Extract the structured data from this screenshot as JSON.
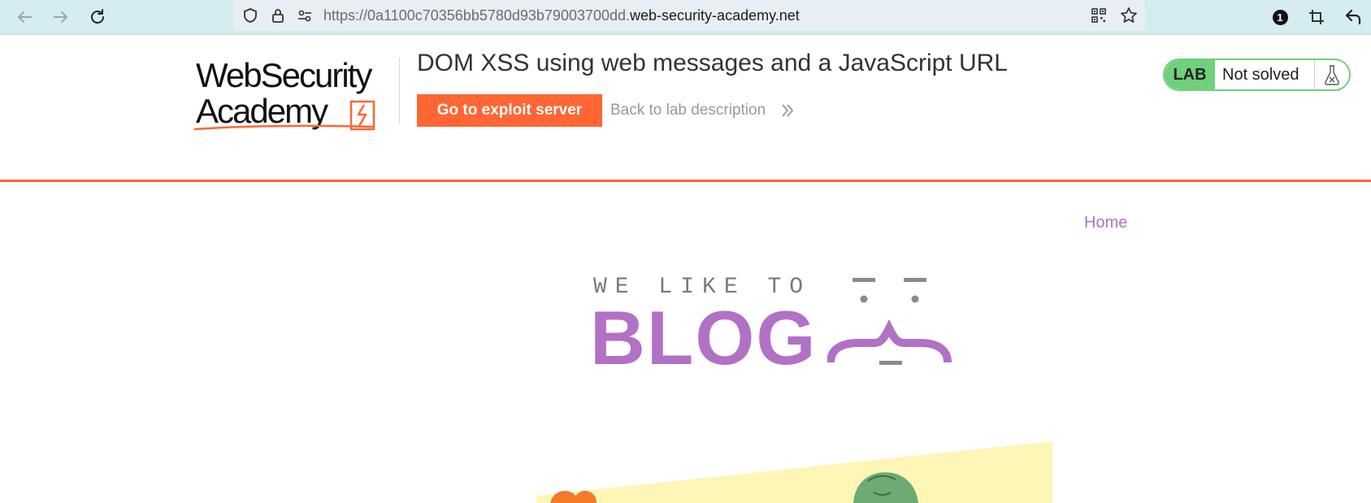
{
  "browser": {
    "url_prefix": "https://0a1100c70356bb5780d93b79003700dd.",
    "url_domain": "web-security-academy.net",
    "extension_badge": "1"
  },
  "header": {
    "logo_line1": "WebSecurity",
    "logo_line2": "Academy",
    "lab_title": "DOM XSS using web messages and a JavaScript URL",
    "exploit_button": "Go to exploit server",
    "back_link": "Back to lab description",
    "lab_tag": "LAB",
    "lab_status": "Not solved"
  },
  "page": {
    "nav_home": "Home",
    "blog_tagline": "WE LIKE TO",
    "blog_word": "BLOG"
  },
  "colors": {
    "accent_orange": "#ff6633",
    "status_green": "#70d07c",
    "blog_purple": "#b171c5",
    "toolbar_bg": "#d5ecf2"
  },
  "icons": [
    "back-arrow-icon",
    "forward-arrow-icon",
    "reload-icon",
    "shield-icon",
    "lock-icon",
    "permissions-icon",
    "qr-code-icon",
    "bookmark-star-icon",
    "extension-badge-icon",
    "crop-icon",
    "undo-icon",
    "chevron-double-right-icon",
    "flask-icon"
  ]
}
